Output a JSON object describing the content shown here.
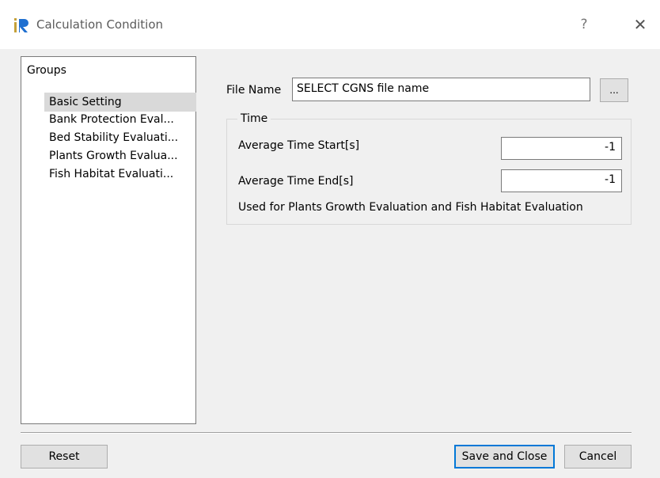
{
  "window": {
    "title": "Calculation Condition",
    "help_label": "?",
    "close_label": "✕"
  },
  "groups": {
    "header": "Groups",
    "items": [
      {
        "label": "Basic Setting",
        "selected": true
      },
      {
        "label": "Bank Protection Eval..."
      },
      {
        "label": "Bed Stability Evaluati..."
      },
      {
        "label": "Plants Growth Evalua..."
      },
      {
        "label": "Fish Habitat Evaluati..."
      }
    ]
  },
  "file": {
    "label": "File Name",
    "value": "SELECT CGNS file name",
    "browse_label": "..."
  },
  "time": {
    "legend": "Time",
    "start_label": "Average Time Start[s]",
    "start_value": "-1",
    "end_label": "Average Time End[s]",
    "end_value": "-1",
    "note": "Used for Plants Growth Evaluation and Fish Habitat Evaluation"
  },
  "buttons": {
    "reset": "Reset",
    "save_close": "Save and Close",
    "cancel": "Cancel"
  },
  "colors": {
    "accent": "#0078d7",
    "selection": "#d9d9d9",
    "dialog_bg": "#f0f0f0"
  }
}
